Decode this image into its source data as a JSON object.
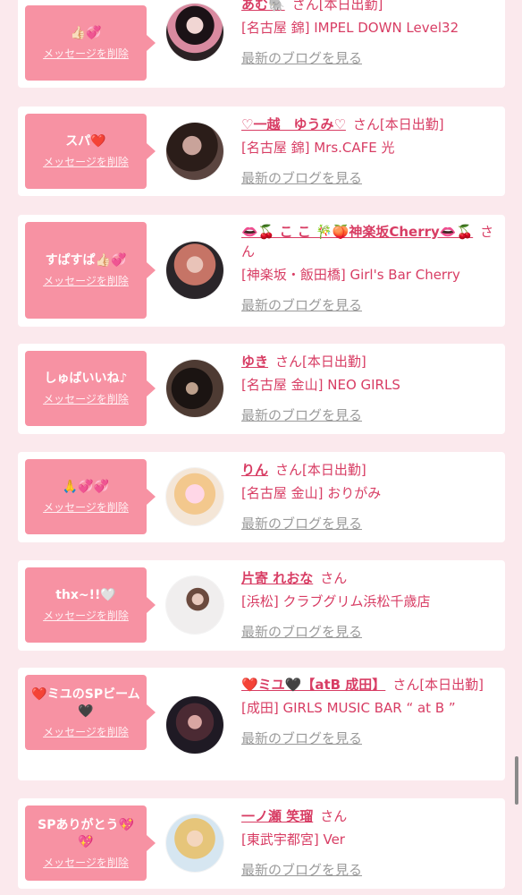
{
  "ui": {
    "delete_label": "メッセージを削除",
    "blog_label": "最新のブログを見る",
    "san_label": "さん",
    "accent_color": "#d83d64",
    "bubble_color": "#f792a3",
    "background_color": "#fbe9ed"
  },
  "entries": [
    {
      "message": "👍🏻💞",
      "name": "あむ🐘",
      "status": "[本日出勤]",
      "shop": "[名古屋 錦] IMPEL DOWN Level32",
      "avatar_icon": "avatar-photo"
    },
    {
      "message": "スパ❤️",
      "name": "♡一越　ゆうみ♡",
      "status": "[本日出勤]",
      "shop": "[名古屋 錦] Mrs.CAFE 光",
      "avatar_icon": "avatar-photo"
    },
    {
      "message": "すぱすぱ👍🏻💞",
      "name": "👄🍒 こ こ 🎋🍑神楽坂Cherry👄🍒",
      "status": "",
      "shop": "[神楽坂・飯田橋] Girl's Bar Cherry",
      "avatar_icon": "avatar-photo"
    },
    {
      "message": "しゅばいいね♪",
      "name": "ゆき",
      "status": "[本日出勤]",
      "shop": "[名古屋 金山] NEO GIRLS",
      "avatar_icon": "avatar-photo"
    },
    {
      "message": "🙏💞💞",
      "name": "りん",
      "status": "[本日出勤]",
      "shop": "[名古屋 金山] おりがみ",
      "avatar_icon": "avatar-photo"
    },
    {
      "message": "thx~!!🤍",
      "name": "片寄 れおな",
      "status": "",
      "shop": "[浜松] クラブグリム浜松千歳店",
      "avatar_icon": "avatar-photo"
    },
    {
      "message": "❤️ミユのSPビーム🖤",
      "name": "❤️ミユ🖤【atB 成田】",
      "status": "[本日出勤]",
      "shop": "[成田] GIRLS MUSIC BAR “ at B ”",
      "avatar_icon": "avatar-photo"
    },
    {
      "message": "SPありがとう💖💖",
      "name": "一ノ瀬 笑瑠",
      "status": "",
      "shop": "[東武宇都宮] Ver",
      "avatar_icon": "avatar-photo"
    }
  ]
}
